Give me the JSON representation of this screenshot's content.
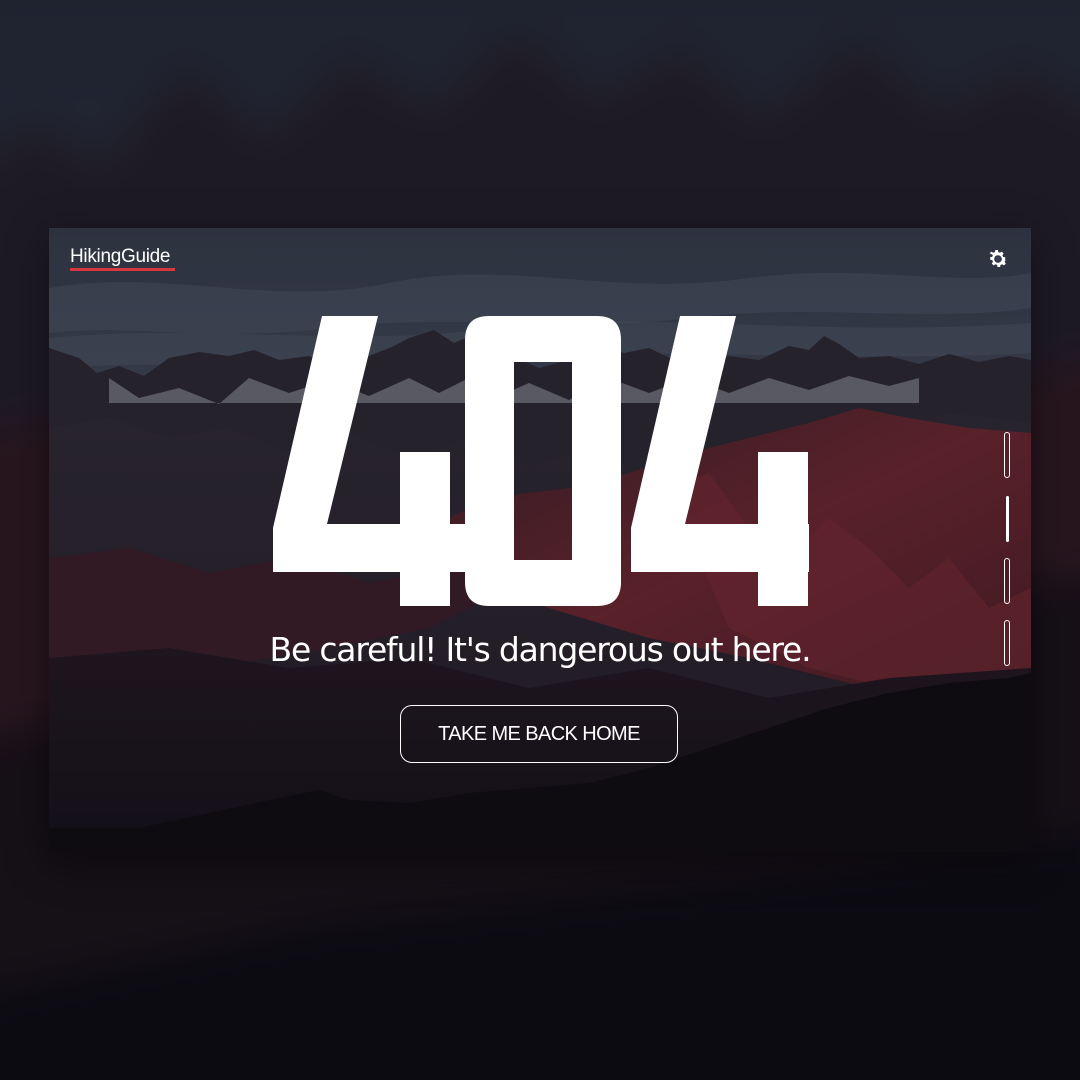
{
  "header": {
    "logo_text": "HikingGuide",
    "accent_color": "#d9363e",
    "settings_icon": "gear-icon"
  },
  "hero": {
    "error_code": "404",
    "message": "Be careful! It's dangerous out here.",
    "cta_label": "TAKE ME BACK HOME"
  },
  "slide_nav": {
    "count": 4,
    "active_index": 1
  },
  "colors": {
    "text": "#ffffff",
    "accent": "#d9363e"
  }
}
